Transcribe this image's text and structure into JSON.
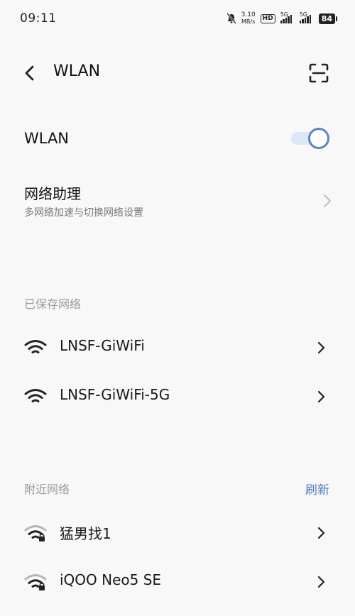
{
  "status_bar": {
    "time": "09:11",
    "speed_value": "3.10",
    "speed_unit": "MB/s",
    "hd_label": "HD",
    "sim1_label": "5G",
    "sim2_label": "5G",
    "battery": "84"
  },
  "header": {
    "title": "WLAN"
  },
  "wlan_toggle": {
    "label": "WLAN",
    "state": "on",
    "accent_color": "#5b84c9"
  },
  "network_assistant": {
    "title": "网络助理",
    "subtitle": "多网络加速与切换网络设置"
  },
  "saved_networks": {
    "header": "已保存网络",
    "items": [
      {
        "name": "LNSF-GiWiFi",
        "icon": "wifi-icon",
        "locked": false
      },
      {
        "name": "LNSF-GiWiFi-5G",
        "icon": "wifi-icon",
        "locked": false
      }
    ]
  },
  "nearby_networks": {
    "header": "附近网络",
    "refresh_label": "刷新",
    "items": [
      {
        "name": "猛男找1",
        "icon": "wifi-lock-icon",
        "locked": true
      },
      {
        "name": "iQOO Neo5 SE",
        "icon": "wifi-lock-icon",
        "locked": true
      }
    ]
  }
}
